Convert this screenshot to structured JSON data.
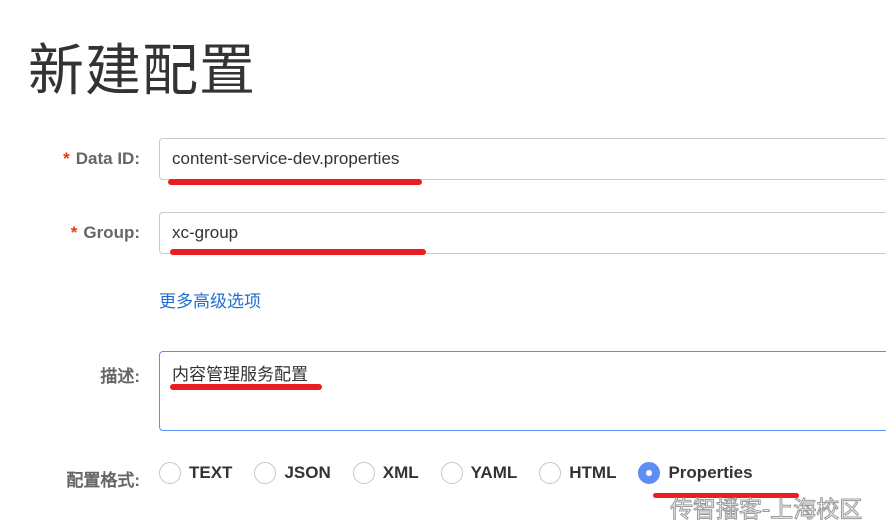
{
  "title": "新建配置",
  "form": {
    "data_id": {
      "label": "Data ID:",
      "required": "*",
      "value": "content-service-dev.properties"
    },
    "group": {
      "label": "Group:",
      "required": "*",
      "value": "xc-group"
    },
    "more_options": "更多高级选项",
    "description": {
      "label": "描述:",
      "value": "内容管理服务配置"
    },
    "format": {
      "label": "配置格式:",
      "options": [
        "TEXT",
        "JSON",
        "XML",
        "YAML",
        "HTML",
        "Properties"
      ],
      "selected": "Properties"
    }
  },
  "watermark": "传智播客-上海校区",
  "colors": {
    "accent": "#5c8ef5",
    "link": "#1f6fd1",
    "annotation": "#ea1c24"
  }
}
